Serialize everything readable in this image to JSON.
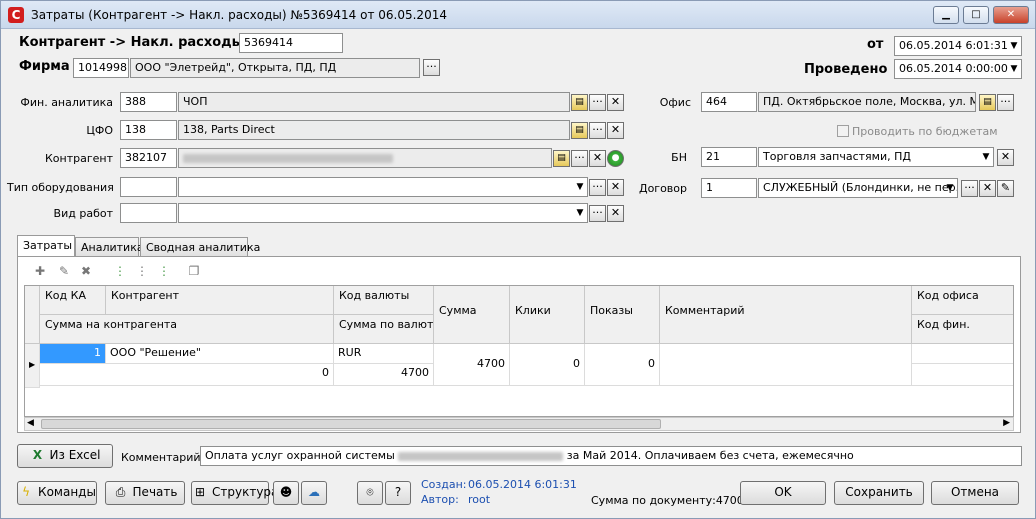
{
  "window": {
    "title": "Затраты (Контрагент -> Накл. расходы) №5369414 от 06.05.2014",
    "app_icon": "С"
  },
  "header": {
    "doc_label": "Контрагент -> Накл. расходы №",
    "doc_number": "5369414",
    "firm_label": "Фирма",
    "firm_code": "1014998",
    "firm_name": "ООО \"Элетрейд\", Открыта, ПД, ПД",
    "date_label": "от",
    "date_value": "06.05.2014 6:01:31",
    "posted_label": "Проведено",
    "posted_value": "06.05.2014 0:00:00"
  },
  "fields": {
    "fin_label": "Фин. аналитика",
    "fin_code": "388",
    "fin_name": "ЧОП",
    "cfo_label": "ЦФО",
    "cfo_code": "138",
    "cfo_name": "138, Parts Direct",
    "contr_label": "Контрагент",
    "contr_code": "382107",
    "equip_label": "Тип оборудования",
    "work_label": "Вид работ",
    "office_label": "Офис",
    "office_code": "464",
    "office_name": "ПД. Октябрьское поле, Москва, ул. Ма...",
    "budget_label": "Проводить по бюджетам",
    "bn_label": "БН",
    "bn_code": "21",
    "bn_name": "Торговля запчастями, ПД",
    "contract_label": "Договор",
    "contract_code": "1",
    "contract_name": "СЛУЖЕБНЫЙ (Блондинки, не пер..."
  },
  "tabs": [
    "Затраты",
    "Аналитика",
    "Сводная аналитика"
  ],
  "grid": {
    "headers": {
      "kod_ka": "Код КА",
      "kontragent": "Контрагент",
      "kod_valuty": "Код валюты",
      "summa_na_kontr": "Сумма на контрагента",
      "summa_po_valute": "Сумма по валюте",
      "summa": "Сумма",
      "kliki": "Клики",
      "pokazy": "Показы",
      "kommentariy": "Комментарий",
      "kod_ofisa": "Код офиса",
      "kod_fin": "Код фин."
    },
    "row": {
      "kod_ka": "1",
      "kontragent": "ООО \"Решение\"",
      "kod_valuty": "RUR",
      "summa_na_kontr": "0",
      "summa_po_valute": "4700",
      "summa": "4700",
      "kliki": "0",
      "pokazy": "0"
    }
  },
  "bottom": {
    "excel_label": "Из Excel",
    "comment_label": "Комментарий",
    "comment_start": "Оплата услуг охранной системы",
    "comment_end": "за Май 2014. Оплачиваем без счета, ежемесячно",
    "commands_label": "Команды",
    "print_label": "Печать",
    "structure_label": "Структура",
    "attach_icon": "paperclip-icon",
    "help_label": "?",
    "created_label": "Создан:",
    "created_value": "06.05.2014 6:01:31",
    "author_label": "Автор:",
    "author_value": "root",
    "total_label": "Сумма по документу:4700",
    "ok_label": "OK",
    "save_label": "Сохранить",
    "cancel_label": "Отмена"
  }
}
